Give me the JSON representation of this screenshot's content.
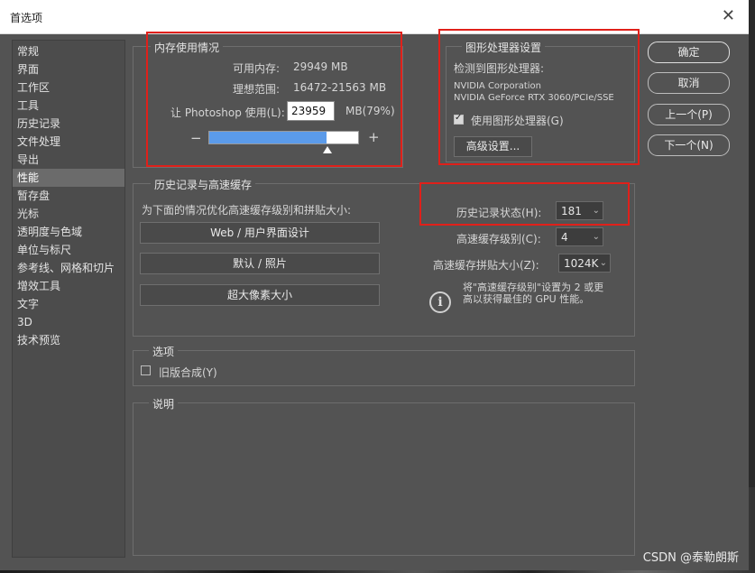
{
  "window": {
    "title": "首选项",
    "close": "✕"
  },
  "sidebar": {
    "items": [
      {
        "label": "常规"
      },
      {
        "label": "界面"
      },
      {
        "label": "工作区"
      },
      {
        "label": "工具"
      },
      {
        "label": "历史记录"
      },
      {
        "label": "文件处理"
      },
      {
        "label": "导出"
      },
      {
        "label": "性能"
      },
      {
        "label": "暂存盘"
      },
      {
        "label": "光标"
      },
      {
        "label": "透明度与色域"
      },
      {
        "label": "单位与标尺"
      },
      {
        "label": "参考线、网格和切片"
      },
      {
        "label": "增效工具"
      },
      {
        "label": "文字"
      },
      {
        "label": "3D"
      },
      {
        "label": "技术预览"
      }
    ],
    "selected": "性能"
  },
  "memory": {
    "title": "内存使用情况",
    "available_label": "可用内存:",
    "available_value": "29949 MB",
    "ideal_label": "理想范围:",
    "ideal_value": "16472-21563 MB",
    "let_label": "让 Photoshop 使用(L):",
    "let_value": "23959",
    "unit_percent": "MB(79%)",
    "minus": "−",
    "plus": "+",
    "slider_fraction": 0.79
  },
  "gpu": {
    "title": "图形处理器设置",
    "detected_label": "检测到图形处理器:",
    "vendor": "NVIDIA Corporation",
    "model": "NVIDIA GeForce RTX 3060/PCIe/SSE",
    "use_gpu_label": "使用图形处理器(G)",
    "use_gpu_checked": true,
    "advanced_button": "高级设置..."
  },
  "buttons": {
    "ok": "确定",
    "cancel": "取消",
    "prev": "上一个(P)",
    "next": "下一个(N)"
  },
  "history_cache": {
    "title": "历史记录与高速缓存",
    "optimize_label": "为下面的情况优化高速缓存级别和拼贴大小:",
    "preset_web": "Web / 用户界面设计",
    "preset_default": "默认 / 照片",
    "preset_huge": "超大像素大小",
    "history_states_label": "历史记录状态(H):",
    "history_states_value": "181",
    "cache_levels_label": "高速缓存级别(C):",
    "cache_levels_value": "4",
    "tile_size_label": "高速缓存拼贴大小(Z):",
    "tile_size_value": "1024K",
    "info_line1": "将\"高速缓存级别\"设置为 2 或更",
    "info_line2": "高以获得最佳的 GPU 性能。"
  },
  "options": {
    "title": "选项",
    "legacy_label": "旧版合成(Y)",
    "legacy_checked": false
  },
  "description": {
    "title": "说明"
  },
  "watermark": "CSDN @泰勒朗斯"
}
